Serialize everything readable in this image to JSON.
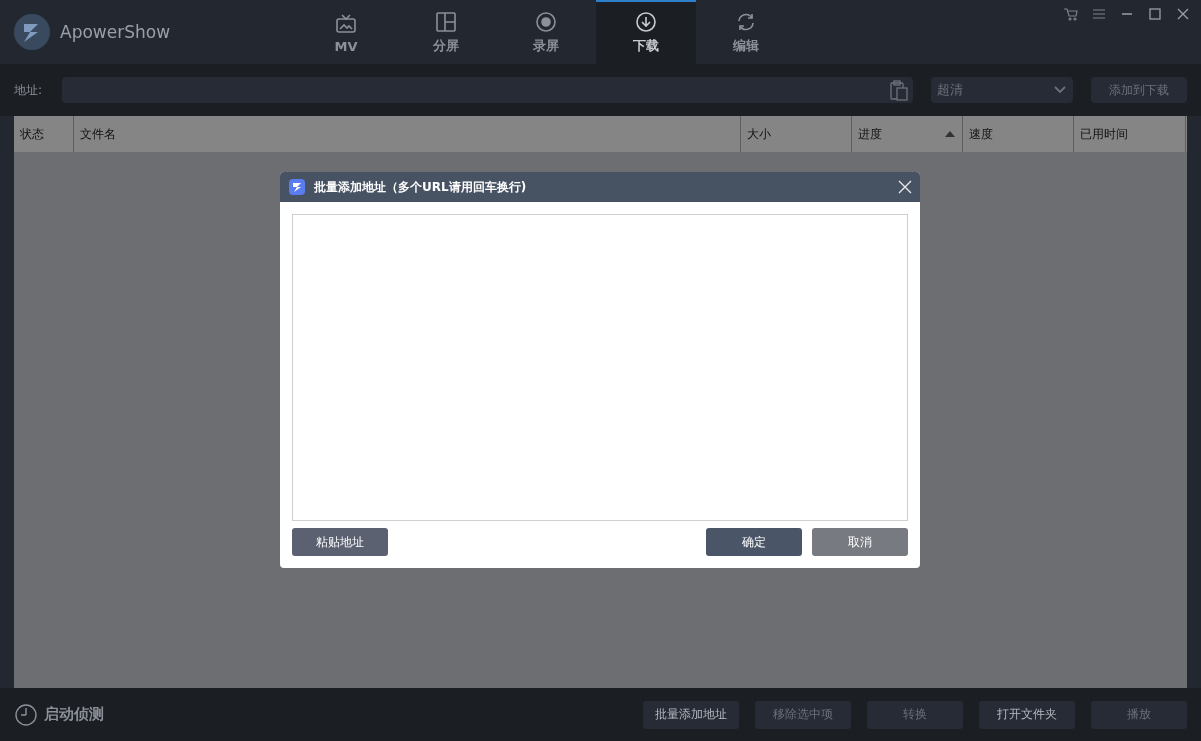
{
  "app": {
    "title": "ApowerShow"
  },
  "tabs": [
    {
      "label": "MV",
      "kind": "tv",
      "selected": false
    },
    {
      "label": "分屏",
      "kind": "split",
      "selected": false
    },
    {
      "label": "录屏",
      "kind": "record",
      "selected": false
    },
    {
      "label": "下载",
      "kind": "download",
      "selected": true
    },
    {
      "label": "编辑",
      "kind": "convert",
      "selected": false
    }
  ],
  "address_bar": {
    "label": "地址:",
    "quality": "超清",
    "add_button": "添加到下载"
  },
  "table": {
    "columns": [
      {
        "label": "状态",
        "sorted": false
      },
      {
        "label": "文件名",
        "sorted": false
      },
      {
        "label": "大小",
        "sorted": false
      },
      {
        "label": "进度",
        "sorted": true
      },
      {
        "label": "速度",
        "sorted": false
      },
      {
        "label": "已用时间",
        "sorted": false
      }
    ]
  },
  "dialog": {
    "title": "批量添加地址（多个URL请用回车换行)",
    "paste_button": "粘贴地址",
    "ok_button": "确定",
    "cancel_button": "取消"
  },
  "footer": {
    "detect_label": "启动侦测",
    "buttons": [
      {
        "label": "批量添加地址",
        "disabled": false
      },
      {
        "label": "移除选中项",
        "disabled": true
      },
      {
        "label": "转换",
        "disabled": true
      },
      {
        "label": "打开文件夹",
        "disabled": false
      },
      {
        "label": "播放",
        "disabled": true
      }
    ]
  }
}
